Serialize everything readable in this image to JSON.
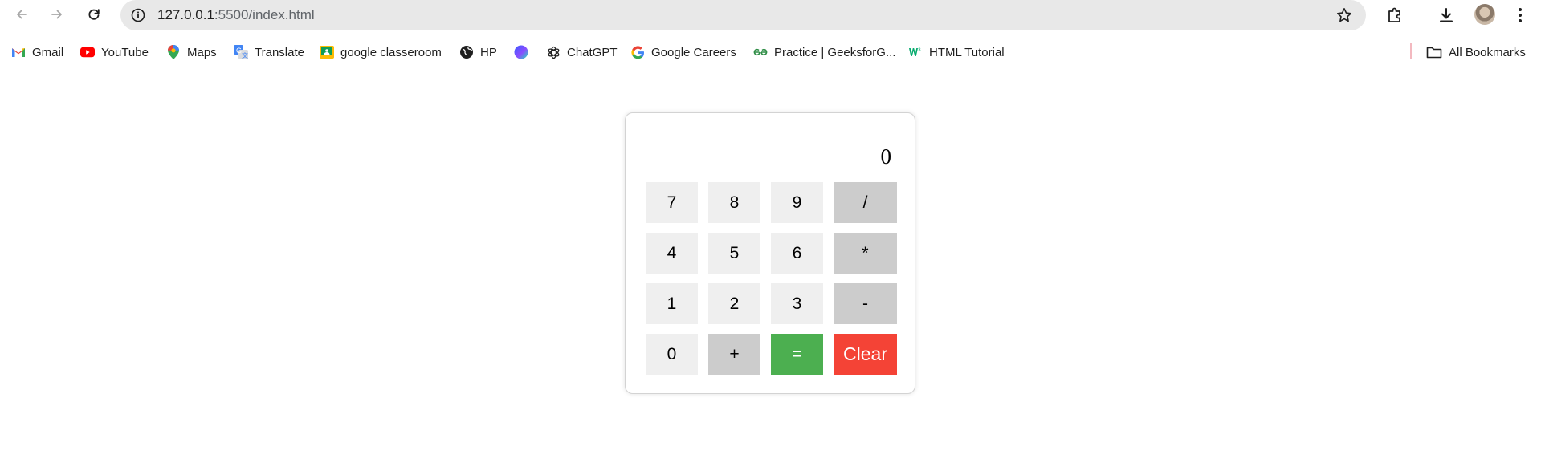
{
  "browser": {
    "url_host": "127.0.0.1",
    "url_path": ":5500/index.html",
    "icons": {
      "back": "back-arrow-icon",
      "forward": "forward-arrow-icon",
      "reload": "reload-icon",
      "site_info": "info-icon",
      "bookmark_star": "star-icon",
      "extensions": "extensions-icon",
      "downloads": "download-icon",
      "menu": "kebab-menu-icon"
    }
  },
  "bookmarks": {
    "items": [
      {
        "label": "Gmail",
        "icon": "gmail-icon"
      },
      {
        "label": "YouTube",
        "icon": "youtube-icon"
      },
      {
        "label": "Maps",
        "icon": "maps-icon"
      },
      {
        "label": "Translate",
        "icon": "translate-icon"
      },
      {
        "label": "google classeroom",
        "icon": "classroom-icon"
      },
      {
        "label": "HP",
        "icon": "globe-icon"
      },
      {
        "label": "",
        "icon": "blue-circle-icon"
      },
      {
        "label": "ChatGPT",
        "icon": "chatgpt-icon"
      },
      {
        "label": "Google Careers",
        "icon": "google-icon"
      },
      {
        "label": "Practice | GeeksforG...",
        "icon": "geeksforgeeks-icon"
      },
      {
        "label": "HTML Tutorial",
        "icon": "w3schools-icon"
      }
    ],
    "all_bookmarks": {
      "label": "All Bookmarks",
      "icon": "folder-icon"
    }
  },
  "calculator": {
    "display_value": "0",
    "keys": [
      {
        "label": "7"
      },
      {
        "label": "8"
      },
      {
        "label": "9"
      },
      {
        "label": "/"
      },
      {
        "label": "4"
      },
      {
        "label": "5"
      },
      {
        "label": "6"
      },
      {
        "label": "*"
      },
      {
        "label": "1"
      },
      {
        "label": "2"
      },
      {
        "label": "3"
      },
      {
        "label": "-"
      },
      {
        "label": "0"
      },
      {
        "label": "+"
      },
      {
        "label": "="
      },
      {
        "label": "Clear"
      }
    ],
    "colors": {
      "digit": "#efefef",
      "operator": "#cccccc",
      "equals": "#4caf50",
      "clear": "#f44336"
    }
  }
}
